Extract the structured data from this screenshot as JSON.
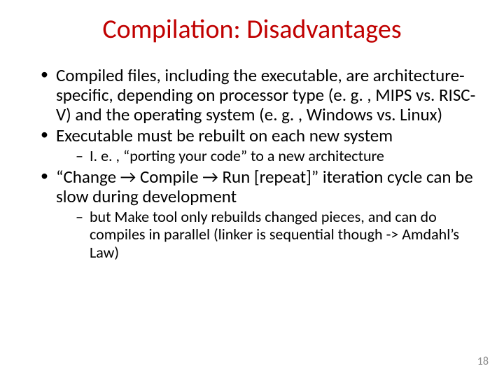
{
  "title_color": "#c00000",
  "title": "Compilation: Disadvantages",
  "bullets": [
    {
      "text": "Compiled files, including the executable, are architecture-specific, depending on processor type (e. g. , MIPS vs. RISC-V) and the operating system (e. g. , Windows vs. Linux)"
    },
    {
      "text": "Executable must be rebuilt on each new system",
      "sub": [
        "I. e. , “porting your code” to a new architecture"
      ]
    },
    {
      "text": "“Change → Compile → Run [repeat]” iteration cycle can be slow during development",
      "sub": [
        "but Make tool only rebuilds changed pieces, and can do compiles in parallel (linker is sequential though -> Amdahl’s Law)"
      ]
    }
  ],
  "page_number": "18"
}
